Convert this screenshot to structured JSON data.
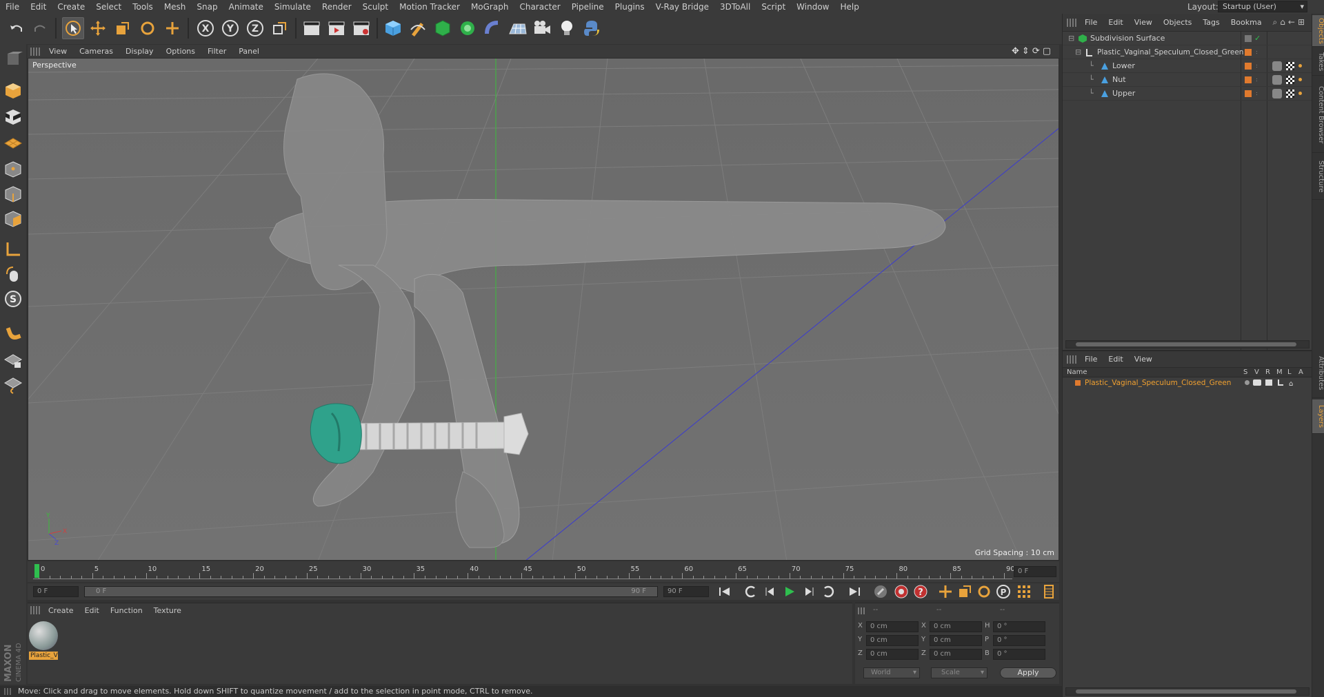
{
  "menu": [
    "File",
    "Edit",
    "Create",
    "Select",
    "Tools",
    "Mesh",
    "Snap",
    "Animate",
    "Simulate",
    "Render",
    "Sculpt",
    "Motion Tracker",
    "MoGraph",
    "Character",
    "Pipeline",
    "Plugins",
    "V-Ray Bridge",
    "3DToAll",
    "Script",
    "Window",
    "Help"
  ],
  "layout": {
    "label": "Layout:",
    "value": "Startup (User)"
  },
  "viewport": {
    "menu": [
      "View",
      "Cameras",
      "Display",
      "Options",
      "Filter",
      "Panel"
    ],
    "label": "Perspective",
    "grid_spacing": "Grid Spacing : 10 cm",
    "axis_labels": {
      "x": "X",
      "y": "Y",
      "z": "Z"
    }
  },
  "objects_panel": {
    "menu": [
      "File",
      "Edit",
      "View",
      "Objects",
      "Tags",
      "Bookma"
    ],
    "items": [
      {
        "name": "Subdivision Surface"
      },
      {
        "name": "Plastic_Vaginal_Speculum_Closed_Green"
      },
      {
        "name": "Lower"
      },
      {
        "name": "Nut"
      },
      {
        "name": "Upper"
      }
    ]
  },
  "layers_panel": {
    "menu": [
      "File",
      "Edit",
      "View"
    ],
    "columns": {
      "name": "Name",
      "flags": [
        "S",
        "V",
        "R",
        "M",
        "L",
        "A"
      ]
    },
    "rows": [
      {
        "name": "Plastic_Vaginal_Speculum_Closed_Green"
      }
    ]
  },
  "side_tabs": [
    "Objects",
    "Takes",
    "Content Browser",
    "Structure",
    "Attributes",
    "Layers"
  ],
  "timeline": {
    "ticks": [
      "0",
      "5",
      "10",
      "15",
      "20",
      "25",
      "30",
      "35",
      "40",
      "45",
      "50",
      "55",
      "60",
      "65",
      "70",
      "75",
      "80",
      "85",
      "90"
    ],
    "current_frame_display": "0 F",
    "start_field": "0 F",
    "range_start": "0 F",
    "range_end": "90 F",
    "end_field": "90 F"
  },
  "material_panel": {
    "menu": [
      "Create",
      "Edit",
      "Function",
      "Texture"
    ],
    "material_label": "Plastic_V"
  },
  "coords": {
    "headers": [
      "--",
      "--",
      "--"
    ],
    "rows": [
      {
        "a": "X",
        "av": "0 cm",
        "b": "X",
        "bv": "0 cm",
        "c": "H",
        "cv": "0 °"
      },
      {
        "a": "Y",
        "av": "0 cm",
        "b": "Y",
        "bv": "0 cm",
        "c": "P",
        "cv": "0 °"
      },
      {
        "a": "Z",
        "av": "0 cm",
        "b": "Z",
        "bv": "0 cm",
        "c": "B",
        "cv": "0 °"
      }
    ],
    "world": "World",
    "scale": "Scale",
    "apply": "Apply"
  },
  "status": "Move: Click and drag to move elements. Hold down SHIFT to quantize movement / add to the selection in point mode, CTRL to remove.",
  "brand": {
    "maxon": "MAXON",
    "product": "CINEMA 4D"
  },
  "colors": {
    "accent": "#e8a33c",
    "layer_orange": "#e07a2e",
    "selected_text": "#f0a030",
    "nut": "#2ca58d"
  }
}
